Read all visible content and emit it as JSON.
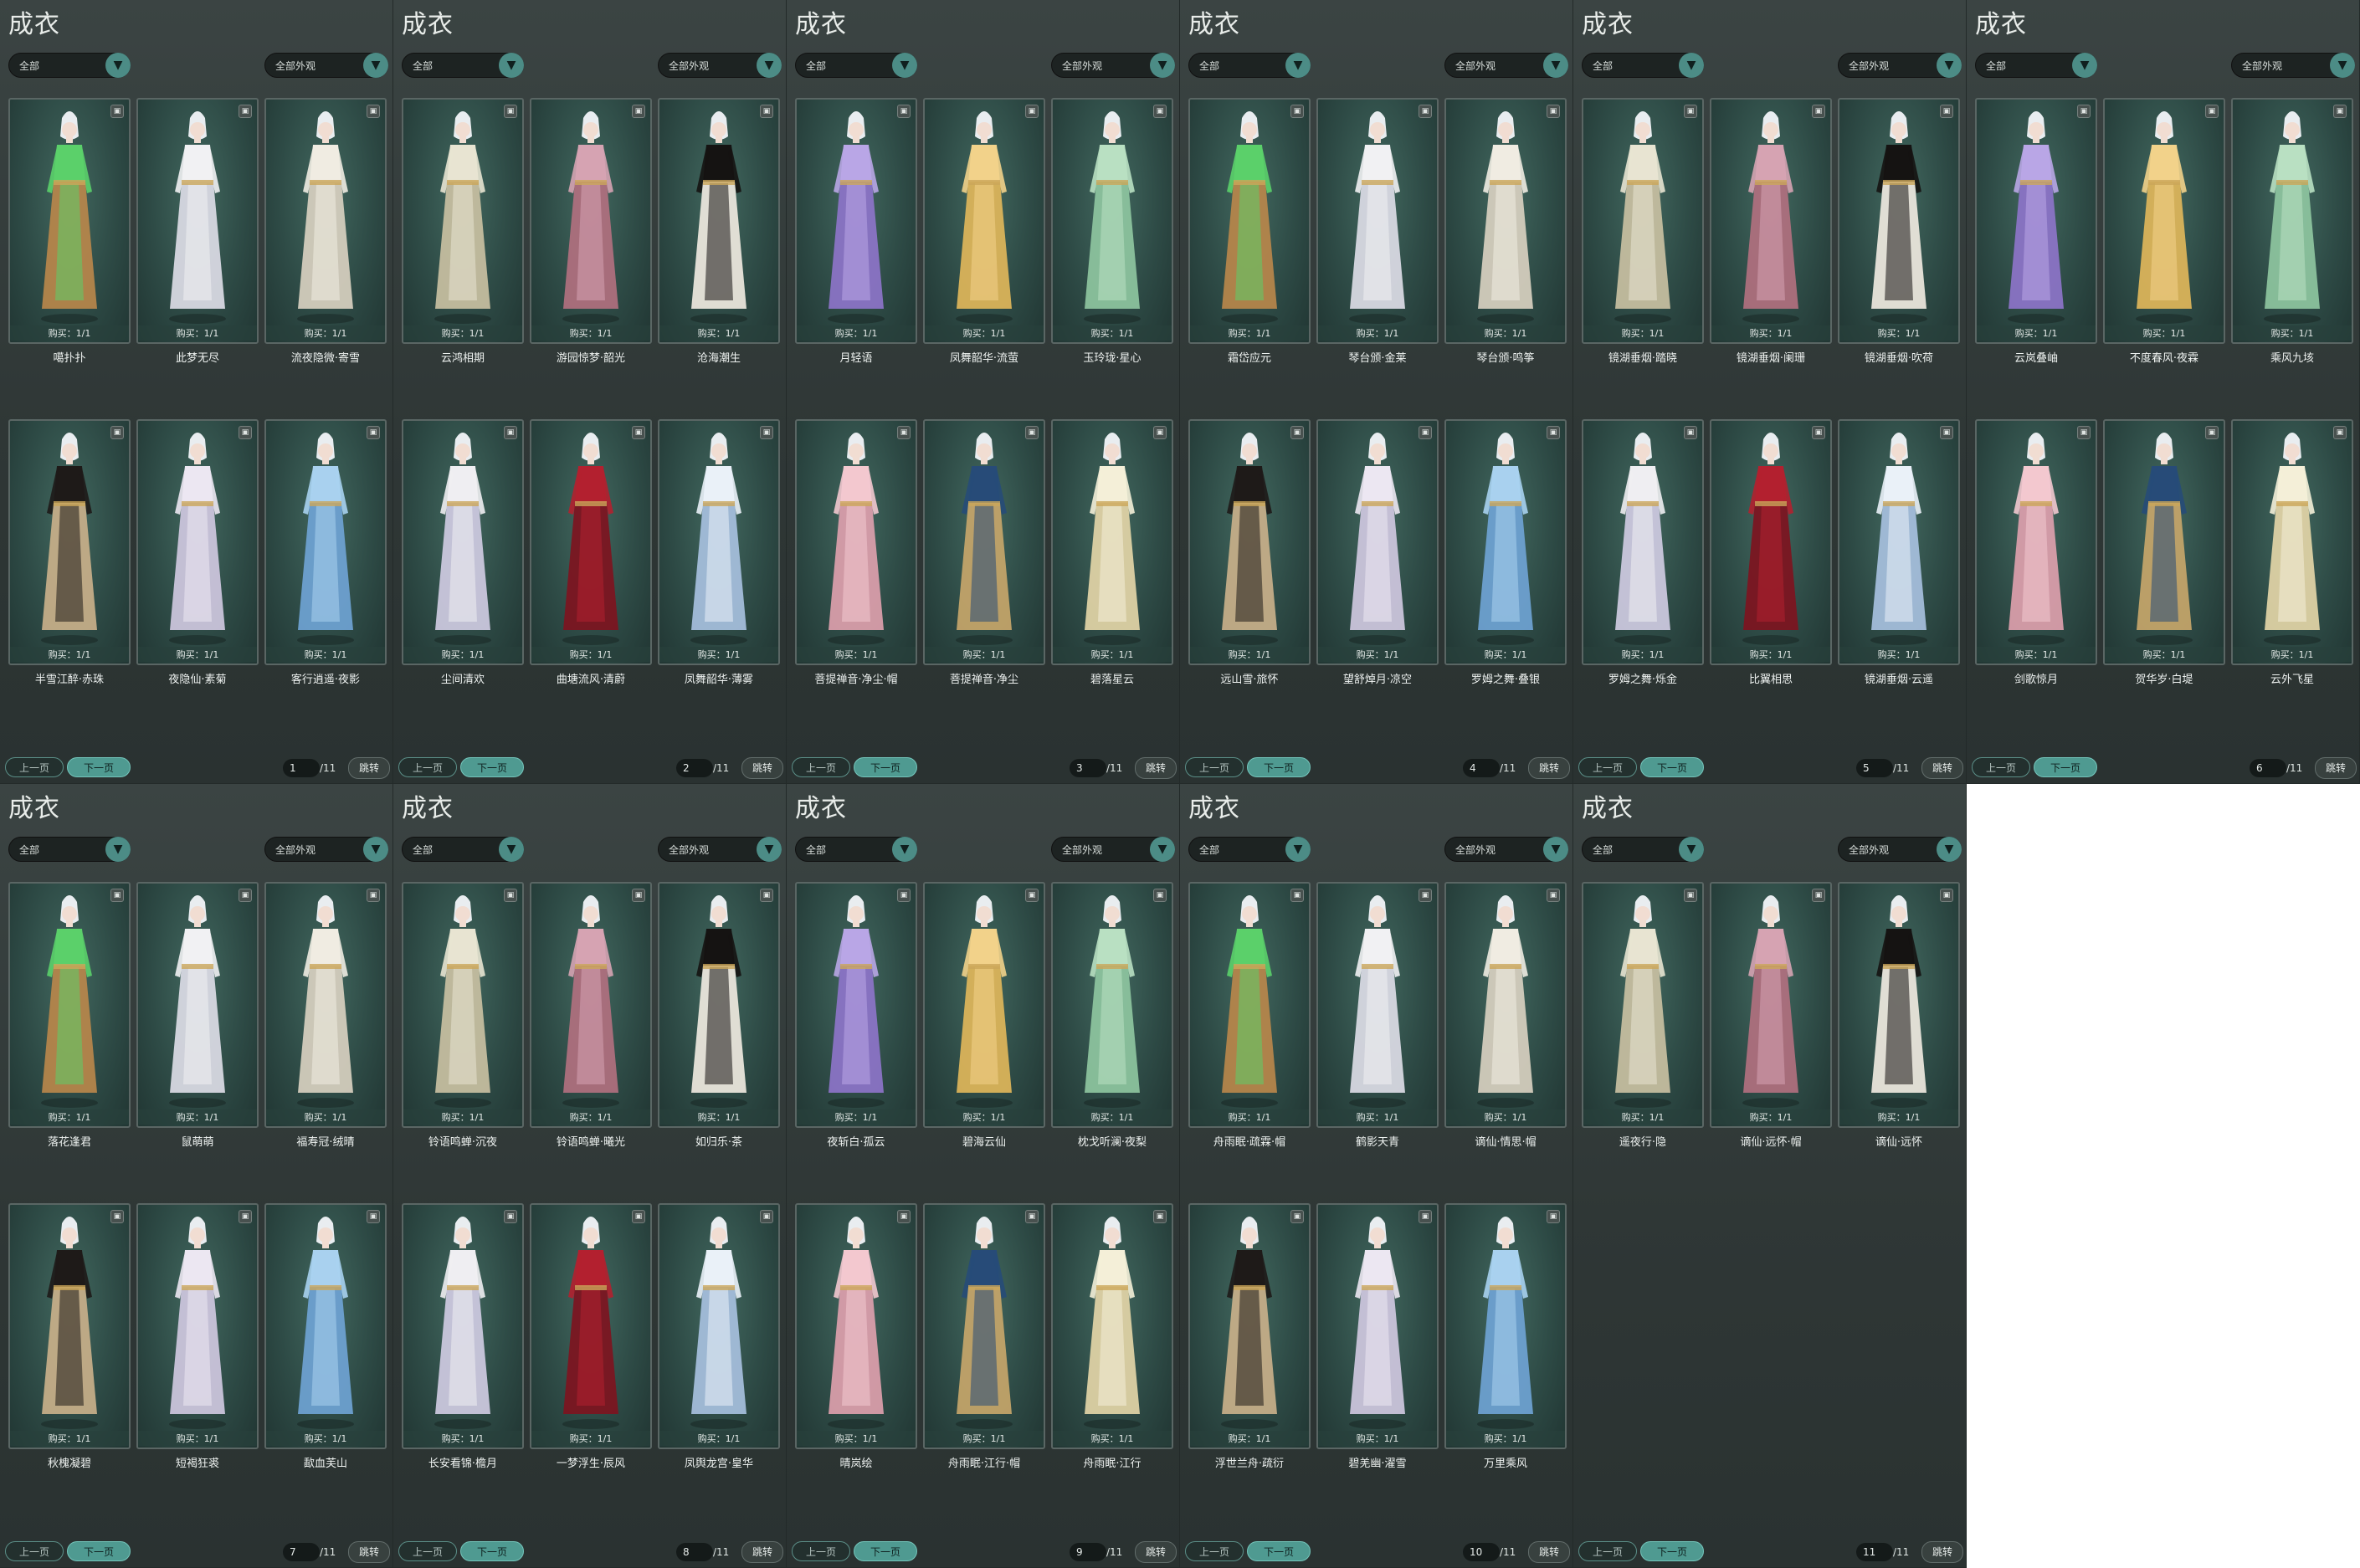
{
  "colors": {
    "panel_bg": "#343c3b",
    "card_bg": "#2e4b46",
    "accent": "#4f9a91",
    "text": "#eef2f0"
  },
  "icons": {
    "card_lock": "lock-icon",
    "dropdown": "chevron-down-icon"
  },
  "pages": [
    {
      "title": "成衣",
      "filter_left": "全部",
      "filter_right": "全部外观",
      "prev_label": "上一页",
      "next_label": "下一页",
      "page": "1",
      "total": "/11",
      "jump_label": "跳转",
      "items": [
        {
          "name": "噶扑扑",
          "buy": "购买：1/1"
        },
        {
          "name": "此梦无尽",
          "buy": "购买：1/1"
        },
        {
          "name": "流夜隐微·寄雪",
          "buy": "购买：1/1"
        },
        {
          "name": "半雪江醉·赤珠",
          "buy": "购买：1/1"
        },
        {
          "name": "夜隐仙·素菊",
          "buy": "购买：1/1"
        },
        {
          "name": "客行逍遥·夜影",
          "buy": "购买：1/1"
        }
      ]
    },
    {
      "title": "成衣",
      "filter_left": "全部",
      "filter_right": "全部外观",
      "prev_label": "上一页",
      "next_label": "下一页",
      "page": "2",
      "total": "/11",
      "jump_label": "跳转",
      "items": [
        {
          "name": "云鸿相期",
          "buy": "购买：1/1"
        },
        {
          "name": "游园惊梦·韶光",
          "buy": "购买：1/1"
        },
        {
          "name": "沧海潮生",
          "buy": "购买：1/1"
        },
        {
          "name": "尘间清欢",
          "buy": "购买：1/1"
        },
        {
          "name": "曲塘流风·清蔚",
          "buy": "购买：1/1"
        },
        {
          "name": "凤舞韶华·薄雾",
          "buy": "购买：1/1"
        }
      ]
    },
    {
      "title": "成衣",
      "filter_left": "全部",
      "filter_right": "全部外观",
      "prev_label": "上一页",
      "next_label": "下一页",
      "page": "3",
      "total": "/11",
      "jump_label": "跳转",
      "items": [
        {
          "name": "月轻语",
          "buy": "购买：1/1"
        },
        {
          "name": "凤舞韶华·流萤",
          "buy": "购买：1/1"
        },
        {
          "name": "玉玲珑·星心",
          "buy": "购买：1/1"
        },
        {
          "name": "菩提禅音·净尘·帽",
          "buy": "购买：1/1"
        },
        {
          "name": "菩提禅音·净尘",
          "buy": "购买：1/1"
        },
        {
          "name": "碧落星云",
          "buy": "购买：1/1"
        }
      ]
    },
    {
      "title": "成衣",
      "filter_left": "全部",
      "filter_right": "全部外观",
      "prev_label": "上一页",
      "next_label": "下一页",
      "page": "4",
      "total": "/11",
      "jump_label": "跳转",
      "items": [
        {
          "name": "霜岱应元",
          "buy": "购买：1/1"
        },
        {
          "name": "琴台颁·金莱",
          "buy": "购买：1/1"
        },
        {
          "name": "琴台颁·鸣筝",
          "buy": "购买：1/1"
        },
        {
          "name": "远山雪·旅怀",
          "buy": "购买：1/1"
        },
        {
          "name": "望舒焯月·凉空",
          "buy": "购买：1/1"
        },
        {
          "name": "罗姆之舞·叠银",
          "buy": "购买：1/1"
        }
      ]
    },
    {
      "title": "成衣",
      "filter_left": "全部",
      "filter_right": "全部外观",
      "prev_label": "上一页",
      "next_label": "下一页",
      "page": "5",
      "total": "/11",
      "jump_label": "跳转",
      "items": [
        {
          "name": "镜湖垂烟·踏晓",
          "buy": "购买：1/1"
        },
        {
          "name": "镜湖垂烟·阑珊",
          "buy": "购买：1/1"
        },
        {
          "name": "镜湖垂烟·吹荷",
          "buy": "购买：1/1"
        },
        {
          "name": "罗姆之舞·烁金",
          "buy": "购买：1/1"
        },
        {
          "name": "比翼相思",
          "buy": "购买：1/1"
        },
        {
          "name": "镜湖垂烟·云遥",
          "buy": "购买：1/1"
        }
      ]
    },
    {
      "title": "成衣",
      "filter_left": "全部",
      "filter_right": "全部外观",
      "prev_label": "上一页",
      "next_label": "下一页",
      "page": "6",
      "total": "/11",
      "jump_label": "跳转",
      "items": [
        {
          "name": "云岚叠岫",
          "buy": "购买：1/1"
        },
        {
          "name": "不度春风·夜霖",
          "buy": "购买：1/1"
        },
        {
          "name": "乘风九垓",
          "buy": "购买：1/1"
        },
        {
          "name": "剑歌惊月",
          "buy": "购买：1/1"
        },
        {
          "name": "贺华岁·白堤",
          "buy": "购买：1/1"
        },
        {
          "name": "云外飞星",
          "buy": "购买：1/1"
        }
      ]
    },
    {
      "title": "成衣",
      "filter_left": "全部",
      "filter_right": "全部外观",
      "prev_label": "上一页",
      "next_label": "下一页",
      "page": "7",
      "total": "/11",
      "jump_label": "跳转",
      "items": [
        {
          "name": "落花逢君",
          "buy": "购买：1/1"
        },
        {
          "name": "鼠萌萌",
          "buy": "购买：1/1"
        },
        {
          "name": "福寿冠·绒晴",
          "buy": "购买：1/1"
        },
        {
          "name": "秋槐凝碧",
          "buy": "购买：1/1"
        },
        {
          "name": "短褐狂裘",
          "buy": "购买：1/1"
        },
        {
          "name": "歃血芙山",
          "buy": "购买：1/1"
        }
      ]
    },
    {
      "title": "成衣",
      "filter_left": "全部",
      "filter_right": "全部外观",
      "prev_label": "上一页",
      "next_label": "下一页",
      "page": "8",
      "total": "/11",
      "jump_label": "跳转",
      "items": [
        {
          "name": "铃语鸣蝉·沉夜",
          "buy": "购买：1/1"
        },
        {
          "name": "铃语鸣蝉·曦光",
          "buy": "购买：1/1"
        },
        {
          "name": "如归乐·茶",
          "buy": "购买：1/1"
        },
        {
          "name": "长安看锦·檐月",
          "buy": "购买：1/1"
        },
        {
          "name": "一梦浮生·辰风",
          "buy": "购买：1/1"
        },
        {
          "name": "凤舆龙宫·皇华",
          "buy": "购买：1/1"
        }
      ]
    },
    {
      "title": "成衣",
      "filter_left": "全部",
      "filter_right": "全部外观",
      "prev_label": "上一页",
      "next_label": "下一页",
      "page": "9",
      "total": "/11",
      "jump_label": "跳转",
      "items": [
        {
          "name": "夜斩白·孤云",
          "buy": "购买：1/1"
        },
        {
          "name": "碧海云仙",
          "buy": "购买：1/1"
        },
        {
          "name": "枕戈听澜·夜梨",
          "buy": "购买：1/1"
        },
        {
          "name": "晴岚绘",
          "buy": "购买：1/1"
        },
        {
          "name": "舟雨眠·江行·帽",
          "buy": "购买：1/1"
        },
        {
          "name": "舟雨眠·江行",
          "buy": "购买：1/1"
        }
      ]
    },
    {
      "title": "成衣",
      "filter_left": "全部",
      "filter_right": "全部外观",
      "prev_label": "上一页",
      "next_label": "下一页",
      "page": "10",
      "total": "/11",
      "jump_label": "跳转",
      "items": [
        {
          "name": "舟雨眠·疏霖·帽",
          "buy": "购买：1/1"
        },
        {
          "name": "鹤影天青",
          "buy": "购买：1/1"
        },
        {
          "name": "谪仙·情思·帽",
          "buy": "购买：1/1"
        },
        {
          "name": "浮世兰舟·疏衍",
          "buy": "购买：1/1"
        },
        {
          "name": "碧羌幽·濯雪",
          "buy": "购买：1/1"
        },
        {
          "name": "万里乘风",
          "buy": "购买：1/1"
        }
      ]
    },
    {
      "title": "成衣",
      "filter_left": "全部",
      "filter_right": "全部外观",
      "prev_label": "上一页",
      "next_label": "下一页",
      "page": "11",
      "total": "/11",
      "jump_label": "跳转",
      "items": [
        {
          "name": "遥夜行·隐",
          "buy": "购买：1/1"
        },
        {
          "name": "谪仙·远怀·帽",
          "buy": "购买：1/1"
        },
        {
          "name": "谪仙·远怀",
          "buy": "购买：1/1"
        }
      ]
    }
  ]
}
